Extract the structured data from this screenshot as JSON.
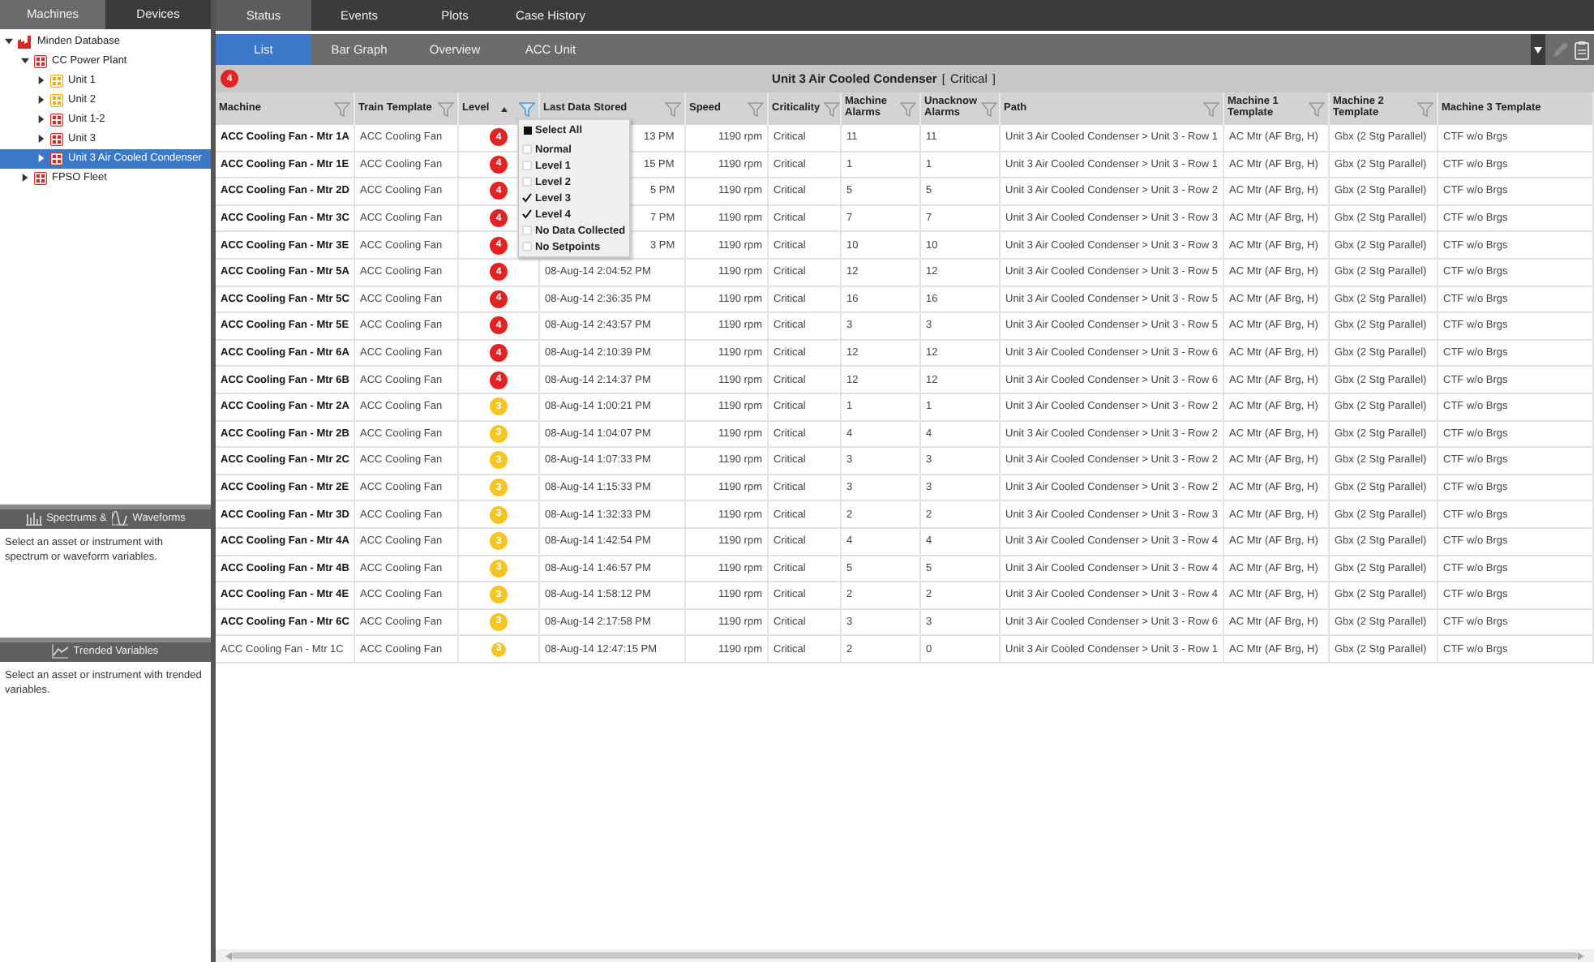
{
  "left_tabs": [
    {
      "label": "Machines",
      "selected": true
    },
    {
      "label": "Devices",
      "selected": false
    }
  ],
  "tree": [
    {
      "label": "Minden Database",
      "kind": "database",
      "color": "#d42a2a",
      "expanded": true,
      "selected": false,
      "children": [
        {
          "label": "CC Power Plant",
          "kind": "plant",
          "color": "#d42a2a",
          "expanded": true,
          "selected": false,
          "children": [
            {
              "label": "Unit 1",
              "kind": "plant",
              "color": "#e8b020",
              "expanded": false,
              "selected": false
            },
            {
              "label": "Unit 2",
              "kind": "plant",
              "color": "#e8b020",
              "expanded": false,
              "selected": false
            },
            {
              "label": "Unit 1-2",
              "kind": "plant",
              "color": "#d42a2a",
              "expanded": false,
              "selected": false
            },
            {
              "label": "Unit 3",
              "kind": "plant",
              "color": "#d42a2a",
              "expanded": false,
              "selected": false
            },
            {
              "label": "Unit 3 Air Cooled Condenser",
              "kind": "plant",
              "color": "#d42a2a",
              "expanded": false,
              "selected": true
            }
          ]
        },
        {
          "label": "FPSO Fleet",
          "kind": "plant",
          "color": "#d42a2a",
          "expanded": false,
          "selected": false
        }
      ]
    }
  ],
  "spectrum_panel": {
    "title_part1": "Spectrums &",
    "title_part2": "Waveforms",
    "message": "Select an asset or instrument with spectrum or waveform variables."
  },
  "trend_panel": {
    "title": "Trended Variables",
    "message": "Select an asset or instrument with trended variables."
  },
  "main_tabs": [
    {
      "label": "Status",
      "selected": true
    },
    {
      "label": "Events",
      "selected": false
    },
    {
      "label": "Plots",
      "selected": false
    },
    {
      "label": "Case History",
      "selected": false
    }
  ],
  "sub_tabs": [
    {
      "label": "List",
      "selected": true
    },
    {
      "label": "Bar Graph",
      "selected": false
    },
    {
      "label": "Overview",
      "selected": false
    },
    {
      "label": "ACC Unit",
      "selected": false
    }
  ],
  "title_bar": {
    "badge": "4",
    "color": "#e02424",
    "asset": "Unit 3 Air Cooled Condenser",
    "open_bracket": "[",
    "status": "Critical",
    "close_bracket": "]"
  },
  "columns": [
    {
      "label": "Machine",
      "filterable": true,
      "filter_active": false,
      "sorted": false
    },
    {
      "label": "Train Template",
      "filterable": true,
      "filter_active": false,
      "sorted": false
    },
    {
      "label": "Level",
      "filterable": true,
      "filter_active": true,
      "sorted": true
    },
    {
      "label": "Last Data Stored",
      "filterable": true,
      "filter_active": false,
      "sorted": false
    },
    {
      "label": "Speed",
      "filterable": true,
      "filter_active": false,
      "sorted": false
    },
    {
      "label": "Criticality",
      "filterable": true,
      "filter_active": false,
      "sorted": false
    },
    {
      "label": "Machine Alarms",
      "filterable": true,
      "filter_active": false,
      "sorted": false
    },
    {
      "label": "Unacknow Alarms",
      "filterable": true,
      "filter_active": false,
      "sorted": false
    },
    {
      "label": "Path",
      "filterable": true,
      "filter_active": false,
      "sorted": false
    },
    {
      "label": "Machine 1 Template",
      "filterable": true,
      "filter_active": false,
      "sorted": false
    },
    {
      "label": "Machine 2 Template",
      "filterable": true,
      "filter_active": false,
      "sorted": false
    },
    {
      "label": "Machine 3 Template",
      "filterable": false,
      "sorted": false
    }
  ],
  "filter_menu": {
    "items": [
      {
        "label": "Select All",
        "kind": "select_all"
      },
      {
        "label": "Normal",
        "kind": "option",
        "checked": false
      },
      {
        "label": "Level 1",
        "kind": "option",
        "checked": false
      },
      {
        "label": "Level 2",
        "kind": "option",
        "checked": false
      },
      {
        "label": "Level 3",
        "kind": "option",
        "checked": true
      },
      {
        "label": "Level 4",
        "kind": "option",
        "checked": true
      },
      {
        "label": "No Data Collected",
        "kind": "option",
        "checked": false
      },
      {
        "label": "No Setpoints",
        "kind": "option",
        "checked": false
      }
    ]
  },
  "rows": [
    {
      "machine": "ACC Cooling Fan - Mtr 1A",
      "bold": true,
      "train": "ACC Cooling Fan",
      "level": "4",
      "color": "#e02424",
      "last_data": "13 PM",
      "speed": "1190 rpm",
      "criticality": "Critical",
      "alarms": "11",
      "unack": "11",
      "path": "Unit 3 Air Cooled Condenser > Unit 3 - Row 1",
      "m1": "AC Mtr (AF Brg, H)",
      "m2": "Gbx (2 Stg Parallel)",
      "m3": "CTF w/o Brgs"
    },
    {
      "machine": "ACC Cooling Fan - Mtr 1E",
      "bold": true,
      "train": "ACC Cooling Fan",
      "level": "4",
      "color": "#e02424",
      "last_data": "15 PM",
      "speed": "1190 rpm",
      "criticality": "Critical",
      "alarms": "1",
      "unack": "1",
      "path": "Unit 3 Air Cooled Condenser > Unit 3 - Row 1",
      "m1": "AC Mtr (AF Brg, H)",
      "m2": "Gbx (2 Stg Parallel)",
      "m3": "CTF w/o Brgs"
    },
    {
      "machine": "ACC Cooling Fan - Mtr 2D",
      "bold": true,
      "train": "ACC Cooling Fan",
      "level": "4",
      "color": "#e02424",
      "last_data": "5 PM",
      "speed": "1190 rpm",
      "criticality": "Critical",
      "alarms": "5",
      "unack": "5",
      "path": "Unit 3 Air Cooled Condenser > Unit 3 - Row 2",
      "m1": "AC Mtr (AF Brg, H)",
      "m2": "Gbx (2 Stg Parallel)",
      "m3": "CTF w/o Brgs"
    },
    {
      "machine": "ACC Cooling Fan - Mtr 3C",
      "bold": true,
      "train": "ACC Cooling Fan",
      "level": "4",
      "color": "#e02424",
      "last_data": "7 PM",
      "speed": "1190 rpm",
      "criticality": "Critical",
      "alarms": "7",
      "unack": "7",
      "path": "Unit 3 Air Cooled Condenser > Unit 3 - Row 3",
      "m1": "AC Mtr (AF Brg, H)",
      "m2": "Gbx (2 Stg Parallel)",
      "m3": "CTF w/o Brgs"
    },
    {
      "machine": "ACC Cooling Fan - Mtr 3E",
      "bold": true,
      "train": "ACC Cooling Fan",
      "level": "4",
      "color": "#e02424",
      "last_data": "3 PM",
      "speed": "1190 rpm",
      "criticality": "Critical",
      "alarms": "10",
      "unack": "10",
      "path": "Unit 3 Air Cooled Condenser > Unit 3 - Row 3",
      "m1": "AC Mtr (AF Brg, H)",
      "m2": "Gbx (2 Stg Parallel)",
      "m3": "CTF w/o Brgs"
    },
    {
      "machine": "ACC Cooling Fan - Mtr 5A",
      "bold": true,
      "train": "ACC Cooling Fan",
      "level": "4",
      "color": "#e02424",
      "last_data": "08-Aug-14 2:04:52 PM",
      "speed": "1190 rpm",
      "criticality": "Critical",
      "alarms": "12",
      "unack": "12",
      "path": "Unit 3 Air Cooled Condenser > Unit 3 - Row 5",
      "m1": "AC Mtr (AF Brg, H)",
      "m2": "Gbx (2 Stg Parallel)",
      "m3": "CTF w/o Brgs"
    },
    {
      "machine": "ACC Cooling Fan - Mtr 5C",
      "bold": true,
      "train": "ACC Cooling Fan",
      "level": "4",
      "color": "#e02424",
      "last_data": "08-Aug-14 2:36:35 PM",
      "speed": "1190 rpm",
      "criticality": "Critical",
      "alarms": "16",
      "unack": "16",
      "path": "Unit 3 Air Cooled Condenser > Unit 3 - Row 5",
      "m1": "AC Mtr (AF Brg, H)",
      "m2": "Gbx (2 Stg Parallel)",
      "m3": "CTF w/o Brgs"
    },
    {
      "machine": "ACC Cooling Fan - Mtr 5E",
      "bold": true,
      "train": "ACC Cooling Fan",
      "level": "4",
      "color": "#e02424",
      "last_data": "08-Aug-14 2:43:57 PM",
      "speed": "1190 rpm",
      "criticality": "Critical",
      "alarms": "3",
      "unack": "3",
      "path": "Unit 3 Air Cooled Condenser > Unit 3 - Row 5",
      "m1": "AC Mtr (AF Brg, H)",
      "m2": "Gbx (2 Stg Parallel)",
      "m3": "CTF w/o Brgs"
    },
    {
      "machine": "ACC Cooling Fan - Mtr 6A",
      "bold": true,
      "train": "ACC Cooling Fan",
      "level": "4",
      "color": "#e02424",
      "last_data": "08-Aug-14 2:10:39 PM",
      "speed": "1190 rpm",
      "criticality": "Critical",
      "alarms": "12",
      "unack": "12",
      "path": "Unit 3 Air Cooled Condenser > Unit 3 - Row 6",
      "m1": "AC Mtr (AF Brg, H)",
      "m2": "Gbx (2 Stg Parallel)",
      "m3": "CTF w/o Brgs"
    },
    {
      "machine": "ACC Cooling Fan - Mtr 6B",
      "bold": true,
      "train": "ACC Cooling Fan",
      "level": "4",
      "color": "#e02424",
      "last_data": "08-Aug-14 2:14:37 PM",
      "speed": "1190 rpm",
      "criticality": "Critical",
      "alarms": "12",
      "unack": "12",
      "path": "Unit 3 Air Cooled Condenser > Unit 3 - Row 6",
      "m1": "AC Mtr (AF Brg, H)",
      "m2": "Gbx (2 Stg Parallel)",
      "m3": "CTF w/o Brgs"
    },
    {
      "machine": "ACC Cooling Fan - Mtr 2A",
      "bold": true,
      "train": "ACC Cooling Fan",
      "level": "3",
      "color": "#f5c623",
      "last_data": "08-Aug-14 1:00:21 PM",
      "speed": "1190 rpm",
      "criticality": "Critical",
      "alarms": "1",
      "unack": "1",
      "path": "Unit 3 Air Cooled Condenser > Unit 3 - Row 2",
      "m1": "AC Mtr (AF Brg, H)",
      "m2": "Gbx (2 Stg Parallel)",
      "m3": "CTF w/o Brgs"
    },
    {
      "machine": "ACC Cooling Fan - Mtr 2B",
      "bold": true,
      "train": "ACC Cooling Fan",
      "level": "3",
      "color": "#f5c623",
      "last_data": "08-Aug-14 1:04:07 PM",
      "speed": "1190 rpm",
      "criticality": "Critical",
      "alarms": "4",
      "unack": "4",
      "path": "Unit 3 Air Cooled Condenser > Unit 3 - Row 2",
      "m1": "AC Mtr (AF Brg, H)",
      "m2": "Gbx (2 Stg Parallel)",
      "m3": "CTF w/o Brgs"
    },
    {
      "machine": "ACC Cooling Fan - Mtr 2C",
      "bold": true,
      "train": "ACC Cooling Fan",
      "level": "3",
      "color": "#f5c623",
      "last_data": "08-Aug-14 1:07:33 PM",
      "speed": "1190 rpm",
      "criticality": "Critical",
      "alarms": "3",
      "unack": "3",
      "path": "Unit 3 Air Cooled Condenser > Unit 3 - Row 2",
      "m1": "AC Mtr (AF Brg, H)",
      "m2": "Gbx (2 Stg Parallel)",
      "m3": "CTF w/o Brgs"
    },
    {
      "machine": "ACC Cooling Fan - Mtr 2E",
      "bold": true,
      "train": "ACC Cooling Fan",
      "level": "3",
      "color": "#f5c623",
      "last_data": "08-Aug-14 1:15:33 PM",
      "speed": "1190 rpm",
      "criticality": "Critical",
      "alarms": "3",
      "unack": "3",
      "path": "Unit 3 Air Cooled Condenser > Unit 3 - Row 2",
      "m1": "AC Mtr (AF Brg, H)",
      "m2": "Gbx (2 Stg Parallel)",
      "m3": "CTF w/o Brgs"
    },
    {
      "machine": "ACC Cooling Fan - Mtr 3D",
      "bold": true,
      "train": "ACC Cooling Fan",
      "level": "3",
      "color": "#f5c623",
      "last_data": "08-Aug-14 1:32:33 PM",
      "speed": "1190 rpm",
      "criticality": "Critical",
      "alarms": "2",
      "unack": "2",
      "path": "Unit 3 Air Cooled Condenser > Unit 3 - Row 3",
      "m1": "AC Mtr (AF Brg, H)",
      "m2": "Gbx (2 Stg Parallel)",
      "m3": "CTF w/o Brgs"
    },
    {
      "machine": "ACC Cooling Fan - Mtr 4A",
      "bold": true,
      "train": "ACC Cooling Fan",
      "level": "3",
      "color": "#f5c623",
      "last_data": "08-Aug-14 1:42:54 PM",
      "speed": "1190 rpm",
      "criticality": "Critical",
      "alarms": "4",
      "unack": "4",
      "path": "Unit 3 Air Cooled Condenser > Unit 3 - Row 4",
      "m1": "AC Mtr (AF Brg, H)",
      "m2": "Gbx (2 Stg Parallel)",
      "m3": "CTF w/o Brgs"
    },
    {
      "machine": "ACC Cooling Fan - Mtr 4B",
      "bold": true,
      "train": "ACC Cooling Fan",
      "level": "3",
      "color": "#f5c623",
      "last_data": "08-Aug-14 1:46:57 PM",
      "speed": "1190 rpm",
      "criticality": "Critical",
      "alarms": "5",
      "unack": "5",
      "path": "Unit 3 Air Cooled Condenser > Unit 3 - Row 4",
      "m1": "AC Mtr (AF Brg, H)",
      "m2": "Gbx (2 Stg Parallel)",
      "m3": "CTF w/o Brgs"
    },
    {
      "machine": "ACC Cooling Fan - Mtr 4E",
      "bold": true,
      "train": "ACC Cooling Fan",
      "level": "3",
      "color": "#f5c623",
      "last_data": "08-Aug-14 1:58:12 PM",
      "speed": "1190 rpm",
      "criticality": "Critical",
      "alarms": "2",
      "unack": "2",
      "path": "Unit 3 Air Cooled Condenser > Unit 3 - Row 4",
      "m1": "AC Mtr (AF Brg, H)",
      "m2": "Gbx (2 Stg Parallel)",
      "m3": "CTF w/o Brgs"
    },
    {
      "machine": "ACC Cooling Fan - Mtr 6C",
      "bold": true,
      "train": "ACC Cooling Fan",
      "level": "3",
      "color": "#f5c623",
      "last_data": "08-Aug-14 2:17:58 PM",
      "speed": "1190 rpm",
      "criticality": "Critical",
      "alarms": "3",
      "unack": "3",
      "path": "Unit 3 Air Cooled Condenser > Unit 3 - Row 6",
      "m1": "AC Mtr (AF Brg, H)",
      "m2": "Gbx (2 Stg Parallel)",
      "m3": "CTF w/o Brgs"
    },
    {
      "machine": "ACC Cooling Fan - Mtr 1C",
      "bold": false,
      "train": "ACC Cooling Fan",
      "level": "3",
      "color": "#f5c623",
      "last_data": "08-Aug-14 12:47:15 PM",
      "speed": "1190 rpm",
      "criticality": "Critical",
      "alarms": "2",
      "unack": "0",
      "path": "Unit 3 Air Cooled Condenser > Unit 3 - Row 1",
      "m1": "AC Mtr (AF Brg, H)",
      "m2": "Gbx (2 Stg Parallel)",
      "m3": "CTF w/o Brgs"
    }
  ]
}
